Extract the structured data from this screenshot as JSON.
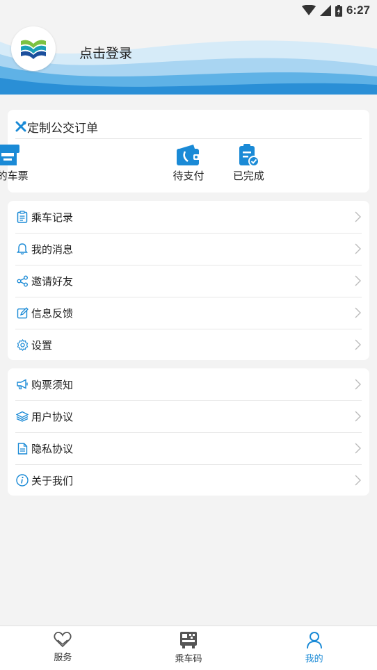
{
  "status_bar": {
    "time": "6:27"
  },
  "header": {
    "login_label": "点击登录"
  },
  "orders": {
    "title": "定制公交订单",
    "items": [
      {
        "label": "我的车票",
        "icon": "ticket-machine-icon"
      },
      {
        "label": "待支付",
        "icon": "wallet-icon"
      },
      {
        "label": "已完成",
        "icon": "clipboard-check-icon"
      }
    ]
  },
  "menu_group_1": [
    {
      "label": "乘车记录",
      "icon": "clipboard-icon"
    },
    {
      "label": "我的消息",
      "icon": "bell-icon"
    },
    {
      "label": "邀请好友",
      "icon": "share-icon"
    },
    {
      "label": "信息反馈",
      "icon": "edit-icon"
    },
    {
      "label": "设置",
      "icon": "gear-icon"
    }
  ],
  "menu_group_2": [
    {
      "label": "购票须知",
      "icon": "megaphone-icon"
    },
    {
      "label": "用户协议",
      "icon": "layers-icon"
    },
    {
      "label": "隐私协议",
      "icon": "document-icon"
    },
    {
      "label": "关于我们",
      "icon": "info-icon"
    }
  ],
  "tabbar": [
    {
      "label": "服务",
      "icon": "heart-icon",
      "active": false
    },
    {
      "label": "乘车码",
      "icon": "qr-bus-icon",
      "active": false
    },
    {
      "label": "我的",
      "icon": "person-icon",
      "active": true
    }
  ],
  "colors": {
    "accent": "#1a8ad6",
    "wave_dark": "#2a8fd6",
    "wave_light": "#a9d5f2"
  }
}
